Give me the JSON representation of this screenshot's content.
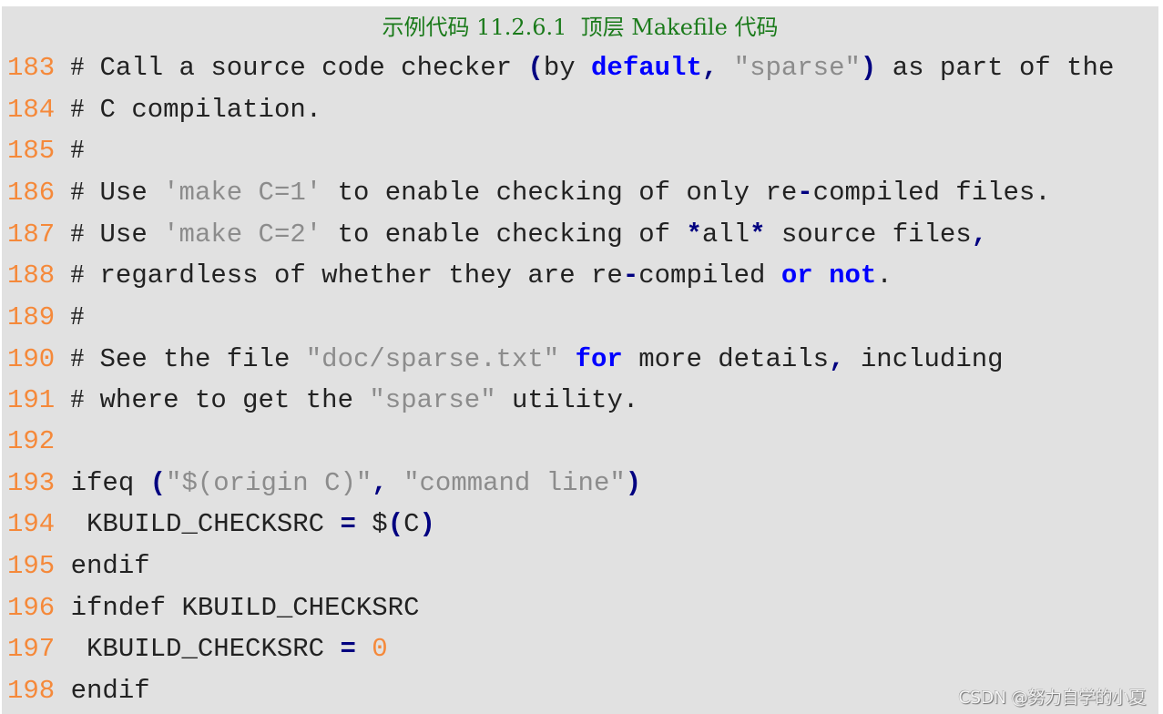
{
  "caption": "示例代码 11.2.6.1  顶层 Makefile 代码",
  "colors": {
    "background": "#e1e1e1",
    "caption": "#1a7a1a",
    "line_number": "#f5893a",
    "text": "#222222",
    "string": "#8c8c8c",
    "keyword": "#0000ff",
    "operator": "#000080",
    "number": "#f5893a"
  },
  "code_lines": [
    {
      "number": "183",
      "tokens": [
        {
          "t": "comment-mark",
          "v": "#"
        },
        {
          "t": "text",
          "v": " Call a source code checker "
        },
        {
          "t": "operator",
          "v": "("
        },
        {
          "t": "text",
          "v": "by "
        },
        {
          "t": "keyword",
          "v": "default"
        },
        {
          "t": "operator",
          "v": ","
        },
        {
          "t": "text",
          "v": " "
        },
        {
          "t": "string",
          "v": "\"sparse\""
        },
        {
          "t": "operator",
          "v": ")"
        },
        {
          "t": "text",
          "v": " as part of the"
        }
      ]
    },
    {
      "number": "184",
      "tokens": [
        {
          "t": "comment-mark",
          "v": "#"
        },
        {
          "t": "text",
          "v": " C compilation."
        }
      ]
    },
    {
      "number": "185",
      "tokens": [
        {
          "t": "comment-mark",
          "v": "#"
        }
      ]
    },
    {
      "number": "186",
      "tokens": [
        {
          "t": "comment-mark",
          "v": "#"
        },
        {
          "t": "text",
          "v": " Use "
        },
        {
          "t": "string",
          "v": "'make C=1'"
        },
        {
          "t": "text",
          "v": " to enable checking of only re"
        },
        {
          "t": "operator",
          "v": "-"
        },
        {
          "t": "text",
          "v": "compiled files."
        }
      ]
    },
    {
      "number": "187",
      "tokens": [
        {
          "t": "comment-mark",
          "v": "#"
        },
        {
          "t": "text",
          "v": " Use "
        },
        {
          "t": "string",
          "v": "'make C=2'"
        },
        {
          "t": "text",
          "v": " to enable checking of "
        },
        {
          "t": "operator",
          "v": "*"
        },
        {
          "t": "text",
          "v": "all"
        },
        {
          "t": "operator",
          "v": "*"
        },
        {
          "t": "text",
          "v": " source files"
        },
        {
          "t": "operator",
          "v": ","
        }
      ]
    },
    {
      "number": "188",
      "tokens": [
        {
          "t": "comment-mark",
          "v": "#"
        },
        {
          "t": "text",
          "v": " regardless of whether they are re"
        },
        {
          "t": "operator",
          "v": "-"
        },
        {
          "t": "text",
          "v": "compiled "
        },
        {
          "t": "keyword",
          "v": "or"
        },
        {
          "t": "text",
          "v": " "
        },
        {
          "t": "keyword",
          "v": "not"
        },
        {
          "t": "text",
          "v": "."
        }
      ]
    },
    {
      "number": "189",
      "tokens": [
        {
          "t": "comment-mark",
          "v": "#"
        }
      ]
    },
    {
      "number": "190",
      "tokens": [
        {
          "t": "comment-mark",
          "v": "#"
        },
        {
          "t": "text",
          "v": " See the file "
        },
        {
          "t": "string",
          "v": "\"doc/sparse.txt\""
        },
        {
          "t": "text",
          "v": " "
        },
        {
          "t": "keyword",
          "v": "for"
        },
        {
          "t": "text",
          "v": " more details"
        },
        {
          "t": "operator",
          "v": ","
        },
        {
          "t": "text",
          "v": " including"
        }
      ]
    },
    {
      "number": "191",
      "tokens": [
        {
          "t": "comment-mark",
          "v": "#"
        },
        {
          "t": "text",
          "v": " where to get the "
        },
        {
          "t": "string",
          "v": "\"sparse\""
        },
        {
          "t": "text",
          "v": " utility."
        }
      ]
    },
    {
      "number": "192",
      "tokens": []
    },
    {
      "number": "193",
      "tokens": [
        {
          "t": "text",
          "v": "ifeq "
        },
        {
          "t": "operator",
          "v": "("
        },
        {
          "t": "string",
          "v": "\"$(origin C)\""
        },
        {
          "t": "operator",
          "v": ","
        },
        {
          "t": "text",
          "v": " "
        },
        {
          "t": "string",
          "v": "\"command line\""
        },
        {
          "t": "operator",
          "v": ")"
        }
      ]
    },
    {
      "number": "194",
      "tokens": [
        {
          "t": "text",
          "v": " KBUILD_CHECKSRC "
        },
        {
          "t": "operator",
          "v": "="
        },
        {
          "t": "text",
          "v": " $"
        },
        {
          "t": "operator",
          "v": "("
        },
        {
          "t": "text",
          "v": "C"
        },
        {
          "t": "operator",
          "v": ")"
        }
      ]
    },
    {
      "number": "195",
      "tokens": [
        {
          "t": "text",
          "v": "endif"
        }
      ]
    },
    {
      "number": "196",
      "tokens": [
        {
          "t": "text",
          "v": "ifndef KBUILD_CHECKSRC"
        }
      ]
    },
    {
      "number": "197",
      "tokens": [
        {
          "t": "text",
          "v": " KBUILD_CHECKSRC "
        },
        {
          "t": "operator",
          "v": "="
        },
        {
          "t": "text",
          "v": " "
        },
        {
          "t": "number",
          "v": "0"
        }
      ]
    },
    {
      "number": "198",
      "tokens": [
        {
          "t": "text",
          "v": "endif"
        }
      ]
    }
  ],
  "watermark": "CSDN @努力自学的小夏"
}
